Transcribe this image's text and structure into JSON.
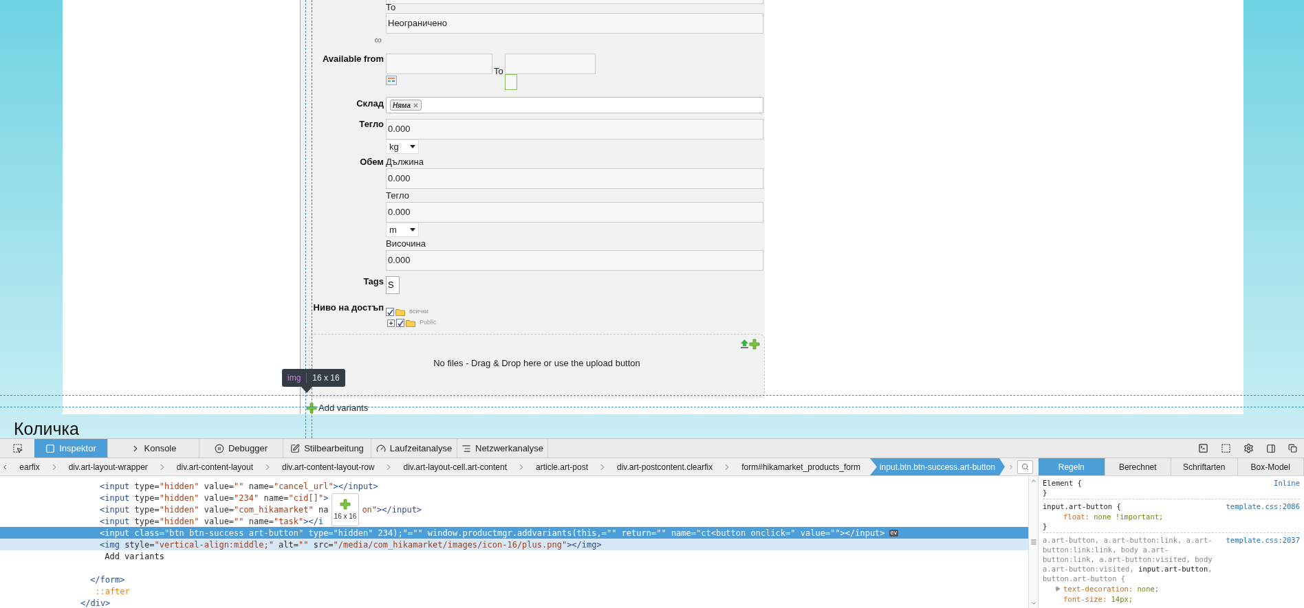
{
  "form": {
    "rows": [
      {
        "kind": "limit",
        "sublabel": "То",
        "value": "Неограничено",
        "symbol": "∞"
      },
      {
        "kind": "date_range",
        "label": "Available from",
        "to_label": "To"
      },
      {
        "kind": "tag_select",
        "label": "Склад",
        "tags": [
          "Няма"
        ]
      },
      {
        "kind": "weight",
        "label": "Тегло",
        "value": "0.000",
        "unit": "kg"
      },
      {
        "kind": "dimensions",
        "label": "Обем",
        "parts": [
          {
            "label": "Дължина",
            "value": "0.000"
          },
          {
            "label": "Тегло",
            "value": "0.000",
            "unit": "m"
          },
          {
            "label": "Височина",
            "value": "0.000"
          }
        ]
      },
      {
        "kind": "tags",
        "label": "Tags",
        "value": "S"
      },
      {
        "kind": "access",
        "label": "Ниво на достъп",
        "tree": [
          {
            "label": "всички",
            "checked": true,
            "children": [
              {
                "label": "Public",
                "checked": true,
                "expanded": false
              }
            ]
          }
        ]
      }
    ],
    "dropzone": {
      "text": "No files - Drag & Drop here or use the upload button"
    },
    "add_variants": "Add variants",
    "tooltip": {
      "tag": "img",
      "size": "16 x 16"
    }
  },
  "below_heading": "Количка",
  "devtools": {
    "tabs": [
      {
        "label": "Inspektor",
        "selected": true
      },
      {
        "label": "Konsole",
        "selected": false
      },
      {
        "label": "Debugger",
        "selected": false
      },
      {
        "label": "Stilbearbeitung",
        "selected": false
      },
      {
        "label": "Laufzeitanalyse",
        "selected": false
      },
      {
        "label": "Netzwerkanalyse",
        "selected": false
      }
    ],
    "breadcrumbs": [
      {
        "label": "earfix",
        "selected": false
      },
      {
        "label": "div.art-layout-wrapper",
        "selected": false
      },
      {
        "label": "div.art-content-layout",
        "selected": false
      },
      {
        "label": "div.art-content-layout-row",
        "selected": false
      },
      {
        "label": "div.art-layout-cell.art-content",
        "selected": false
      },
      {
        "label": "article.art-post",
        "selected": false
      },
      {
        "label": "div.art-postcontent.clearfix",
        "selected": false
      },
      {
        "label": "form#hikamarket_products_form",
        "selected": false
      },
      {
        "label": "input.btn.btn-success.art-button",
        "selected": true
      }
    ],
    "markup": [
      {
        "children": [
          {
            "children": [
              {
                "selected": false,
                "hovered": false,
                "segments": [
                  [
                    {
                      "kind": "tag",
                      "text": "<input"
                    },
                    {
                      "kind": "attr",
                      "text": " type="
                    },
                    {
                      "kind": "value",
                      "text": "\"hidden\""
                    },
                    {
                      "kind": "attr",
                      "text": " value="
                    },
                    {
                      "kind": "value",
                      "text": "\"\""
                    },
                    {
                      "kind": "attr",
                      "text": " name="
                    },
                    {
                      "kind": "value",
                      "text": "\"cancel_url\""
                    },
                    {
                      "kind": "tag",
                      "text": "></input>"
                    }
                  ]
                ]
              },
              {
                "selected": false,
                "hovered": false,
                "segments": [
                  [
                    {
                      "kind": "tag",
                      "text": "<input"
                    },
                    {
                      "kind": "attr",
                      "text": " type="
                    },
                    {
                      "kind": "value",
                      "text": "\"hidden\""
                    },
                    {
                      "kind": "attr",
                      "text": " value="
                    },
                    {
                      "kind": "value",
                      "text": "\"234\""
                    },
                    {
                      "kind": "attr",
                      "text": " name="
                    },
                    {
                      "kind": "value",
                      "text": "\"cid[]\""
                    },
                    {
                      "kind": "tag",
                      "text": ">"
                    }
                  ]
                ]
              },
              {
                "selected": false,
                "hovered": false,
                "segments": [
                  [
                    {
                      "kind": "tag",
                      "text": "<input"
                    },
                    {
                      "kind": "attr",
                      "text": " type="
                    },
                    {
                      "kind": "value",
                      "text": "\"hidden\""
                    },
                    {
                      "kind": "attr",
                      "text": " value="
                    },
                    {
                      "kind": "value",
                      "text": "\"com_hikamarket\""
                    },
                    {
                      "kind": "attr",
                      "text": " na"
                    }
                  ],
                  [
                    {
                      "kind": "value",
                      "text": "on\""
                    },
                    {
                      "kind": "tag",
                      "text": "></input>"
                    }
                  ]
                ]
              },
              {
                "selected": false,
                "hovered": false,
                "segments": [
                  [
                    {
                      "kind": "tag",
                      "text": "<input"
                    },
                    {
                      "kind": "attr",
                      "text": " type="
                    },
                    {
                      "kind": "value",
                      "text": "\"hidden\""
                    },
                    {
                      "kind": "attr",
                      "text": " value="
                    },
                    {
                      "kind": "value",
                      "text": "\"\""
                    },
                    {
                      "kind": "attr",
                      "text": " name="
                    },
                    {
                      "kind": "value",
                      "text": "\"task\""
                    },
                    {
                      "kind": "tag",
                      "text": "></i"
                    }
                  ]
                ]
              },
              {
                "selected": true,
                "hovered": false,
                "badge": "ev",
                "segments": [
                  [
                    {
                      "kind": "tag",
                      "text": "<input"
                    },
                    {
                      "kind": "attr",
                      "text": " class="
                    },
                    {
                      "kind": "value",
                      "text": "\"btn btn-success art-button\""
                    },
                    {
                      "kind": "attr",
                      "text": " type="
                    },
                    {
                      "kind": "value",
                      "text": "\"hidden\""
                    },
                    {
                      "kind": "attr",
                      "text": " 234);\"="
                    },
                    {
                      "kind": "value",
                      "text": "\"\""
                    },
                    {
                      "kind": "attr",
                      "text": " window.productmgr.addvariants(this,="
                    },
                    {
                      "kind": "value",
                      "text": "\"\""
                    },
                    {
                      "kind": "attr",
                      "text": " return="
                    },
                    {
                      "kind": "value",
                      "text": "\"\""
                    },
                    {
                      "kind": "attr",
                      "text": " name="
                    },
                    {
                      "kind": "value",
                      "text": "\"ct<button onclick=\""
                    },
                    {
                      "kind": "attr",
                      "text": " value="
                    },
                    {
                      "kind": "value",
                      "text": "\"\""
                    },
                    {
                      "kind": "tag",
                      "text": "></input>"
                    }
                  ]
                ]
              },
              {
                "selected": false,
                "hovered": true,
                "segments": [
                  [
                    {
                      "kind": "tag",
                      "text": "<img"
                    },
                    {
                      "kind": "attr",
                      "text": " style="
                    },
                    {
                      "kind": "value",
                      "text": "\"vertical-align:middle;\""
                    },
                    {
                      "kind": "attr",
                      "text": " alt="
                    },
                    {
                      "kind": "value",
                      "text": "\"\""
                    },
                    {
                      "kind": "attr",
                      "text": " src="
                    },
                    {
                      "kind": "value",
                      "text": "\"/media/com_hikamarket/images/icon-16/plus.png\""
                    },
                    {
                      "kind": "tag",
                      "text": "></img>"
                    }
                  ]
                ]
              },
              {
                "selected": false,
                "hovered": false,
                "segments": [
                  [
                    {
                      "kind": "text",
                      "text": " Add variants"
                    }
                  ]
                ]
              }
            ]
          },
          {
            "selected": false,
            "hovered": false,
            "segments": [
              [
                {
                  "kind": "tag",
                  "text": "</form>"
                }
              ]
            ]
          },
          {
            "selected": false,
            "hovered": false,
            "segments": [
              [
                {
                  "kind": "pseudo",
                  "text": " ::after"
                }
              ]
            ]
          }
        ]
      },
      {
        "selected": false,
        "hovered": false,
        "segments": [
          [
            {
              "kind": "tag",
              "text": "</div>"
            }
          ]
        ]
      }
    ],
    "code_tooltip": "16 x 16",
    "side_tabs": [
      {
        "label": "Regeln",
        "selected": true
      },
      {
        "label": "Berechnet",
        "selected": false
      },
      {
        "label": "Schriftarten",
        "selected": false
      },
      {
        "label": "Box-Model",
        "selected": false
      }
    ],
    "rules": [
      {
        "selector": [
          {
            "text": "Element {",
            "matched": true
          }
        ],
        "source": "Inline",
        "close": "}"
      },
      {
        "selector": [
          {
            "text": "input.art-button {",
            "matched": true
          }
        ],
        "source": "template.css:2086",
        "declarations": [
          {
            "property": "float:",
            "value": "none !important;",
            "expandable": false
          }
        ],
        "close": "}"
      },
      {
        "selector": [
          {
            "text": "a.art-button, a.art-button:link, a.art-button:link:link, body a.art-button:link, a.art-button:visited, body a.art-button:visited, ",
            "matched": false
          },
          {
            "text": "input.art-button",
            "matched": true
          },
          {
            "text": ", button.art-button {",
            "matched": false
          }
        ],
        "source": "template.css:2037",
        "declarations": [
          {
            "property": "text-decoration:",
            "value": "none;",
            "expandable": true
          },
          {
            "property": "font-size:",
            "value": "14px;",
            "expandable": false
          }
        ]
      }
    ]
  }
}
